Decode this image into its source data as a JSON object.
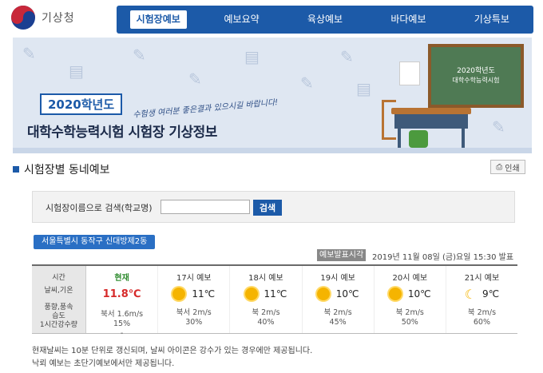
{
  "header": {
    "logo_text": "기상청",
    "nav": [
      {
        "label": "시험장예보",
        "active": true
      },
      {
        "label": "예보요약",
        "active": false
      },
      {
        "label": "육상예보",
        "active": false
      },
      {
        "label": "바다예보",
        "active": false
      },
      {
        "label": "기상특보",
        "active": false
      }
    ]
  },
  "banner": {
    "year": "2020학년도",
    "slogan": "수험생 여러분 좋은결과 있으시길 바랍니다!",
    "title": "대학수학능력시험 시험장 기상정보",
    "board_line1": "2020학년도",
    "board_line2": "대학수학능력시험"
  },
  "section": {
    "title": "시험장별 동네예보",
    "print_label": "인쇄",
    "print_icon": "printer-icon"
  },
  "search": {
    "label": "시험장이름으로 검색(학교명)",
    "value": "",
    "placeholder": "",
    "button": "검색"
  },
  "location": "서울특별시 동작구 신대방제2동",
  "timestamp": {
    "label": "예보발표시각",
    "value": "2019년 11월 08일 (금)요일 15:30 발표"
  },
  "table": {
    "labels": [
      "시간",
      "날씨,기온",
      "풍향,풍속",
      "습도",
      "1시간강수량"
    ],
    "current": {
      "header": "현재",
      "temp": "11.8℃",
      "wind": "북서 1.6m/s",
      "humidity": "15%",
      "rain": "-"
    },
    "forecasts": [
      {
        "header": "17시 예보",
        "icon": "sun-icon",
        "temp": "11℃",
        "wind": "북서 2m/s",
        "humidity": "30%"
      },
      {
        "header": "18시 예보",
        "icon": "sun-icon",
        "temp": "11℃",
        "wind": "북 2m/s",
        "humidity": "40%"
      },
      {
        "header": "19시 예보",
        "icon": "sun-icon",
        "temp": "10℃",
        "wind": "북 2m/s",
        "humidity": "45%"
      },
      {
        "header": "20시 예보",
        "icon": "sun-icon",
        "temp": "10℃",
        "wind": "북 2m/s",
        "humidity": "50%"
      },
      {
        "header": "21시 예보",
        "icon": "moon-icon",
        "temp": "9℃",
        "wind": "북 2m/s",
        "humidity": "60%"
      }
    ]
  },
  "notes": [
    "현재날씨는 10분 단위로 갱신되며, 날씨 아이콘은 강수가 있는 경우에만 제공됩니다.",
    "낙뢰 예보는 초단기예보에서만 제공됩니다."
  ],
  "colors": {
    "brand": "#1c5aa8",
    "now_header": "#2e8b2e",
    "now_temp": "#d62a2a"
  }
}
